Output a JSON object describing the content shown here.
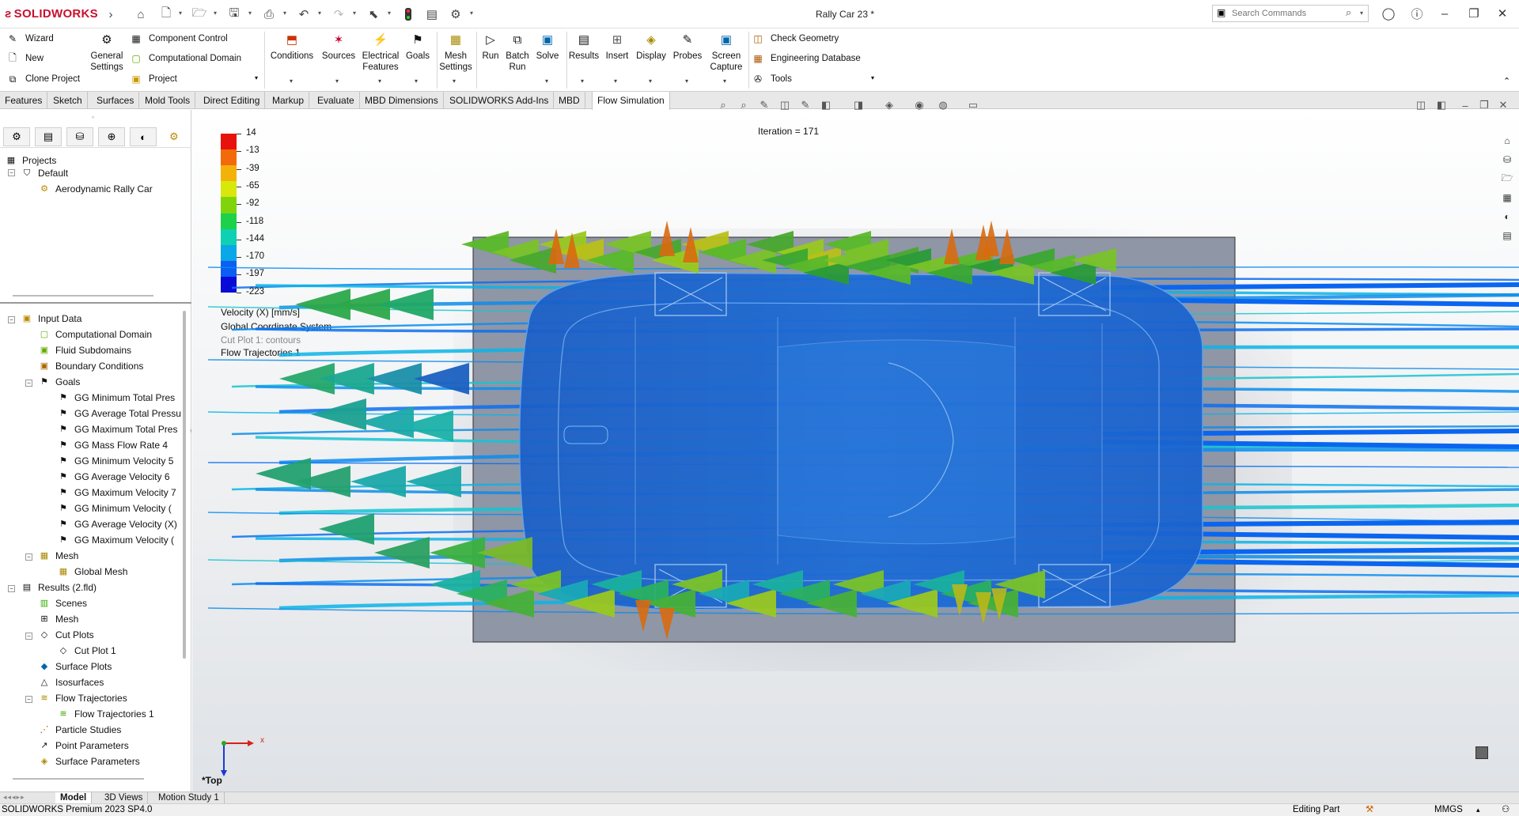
{
  "app": {
    "brand": "SOLIDWORKS",
    "document_title": "Rally Car 23 *"
  },
  "search": {
    "placeholder": "Search Commands"
  },
  "ribbon": {
    "wizard": "Wizard",
    "new": "New",
    "clone_project": "Clone Project",
    "general_settings": "General Settings",
    "component_control": "Component Control",
    "computational_domain": "Computational Domain",
    "project": "Project",
    "conditions": "Conditions",
    "sources": "Sources",
    "electrical_features": "Electrical Features",
    "goals": "Goals",
    "mesh_settings": "Mesh Settings",
    "run": "Run",
    "batch_run": "Batch Run",
    "solve": "Solve",
    "results": "Results",
    "insert": "Insert",
    "display": "Display",
    "probes": "Probes",
    "screen_capture": "Screen Capture",
    "check_geometry": "Check Geometry",
    "engineering_database": "Engineering Database",
    "tools": "Tools"
  },
  "tabs": [
    "Features",
    "Sketch",
    "Surfaces",
    "Mold Tools",
    "Direct Editing",
    "Markup",
    "Evaluate",
    "MBD Dimensions",
    "SOLIDWORKS Add-Ins",
    "MBD",
    "Flow Simulation"
  ],
  "active_tab": "Flow Simulation",
  "tree_top": {
    "projects": "Projects",
    "default": "Default",
    "car": "Aerodynamic Rally Car"
  },
  "tree": {
    "input_data": "Input Data",
    "computational_domain": "Computational Domain",
    "fluid_subdomains": "Fluid Subdomains",
    "boundary_conditions": "Boundary Conditions",
    "goals": "Goals",
    "goal_items": [
      "GG Minimum Total Pres",
      "GG Average Total Pressu",
      "GG Maximum Total Pres",
      "GG Mass Flow Rate 4",
      "GG Minimum Velocity 5",
      "GG Average Velocity 6",
      "GG Maximum Velocity 7",
      "GG Minimum Velocity (",
      "GG Average Velocity (X)",
      "GG Maximum Velocity ("
    ],
    "mesh": "Mesh",
    "global_mesh": "Global Mesh",
    "results": "Results (2.fld)",
    "scenes": "Scenes",
    "results_mesh": "Mesh",
    "cut_plots": "Cut Plots",
    "cut_plot_1": "Cut Plot 1",
    "surface_plots": "Surface Plots",
    "isosurfaces": "Isosurfaces",
    "flow_trajectories": "Flow Trajectories",
    "flow_trajectories_1": "Flow Trajectories 1",
    "particle_studies": "Particle Studies",
    "point_parameters": "Point Parameters",
    "surface_parameters": "Surface Parameters"
  },
  "viewport": {
    "iteration": "Iteration = 171",
    "legend_values": [
      "14",
      "-13",
      "-39",
      "-65",
      "-92",
      "-118",
      "-144",
      "-170",
      "-197",
      "-223"
    ],
    "legend_colors": [
      "#e8120c",
      "#f26a0a",
      "#f4b10a",
      "#d7e80a",
      "#7fd40c",
      "#1ed14a",
      "#0ed1b4",
      "#0aa8e6",
      "#0a5ef2",
      "#0a0ad8"
    ],
    "velocity_label": "Velocity (X) [mm/s]",
    "coord_label": "Global Coordinate System",
    "cut_plot_label": "Cut Plot 1: contours",
    "traj_label": "Flow Trajectories 1",
    "view_label": "*Top",
    "axis_x": "x"
  },
  "bottom_tabs": [
    "Model",
    "3D Views",
    "Motion Study 1"
  ],
  "status": {
    "version": "SOLIDWORKS Premium 2023 SP4.0",
    "editing": "Editing Part",
    "units": "MMGS"
  }
}
